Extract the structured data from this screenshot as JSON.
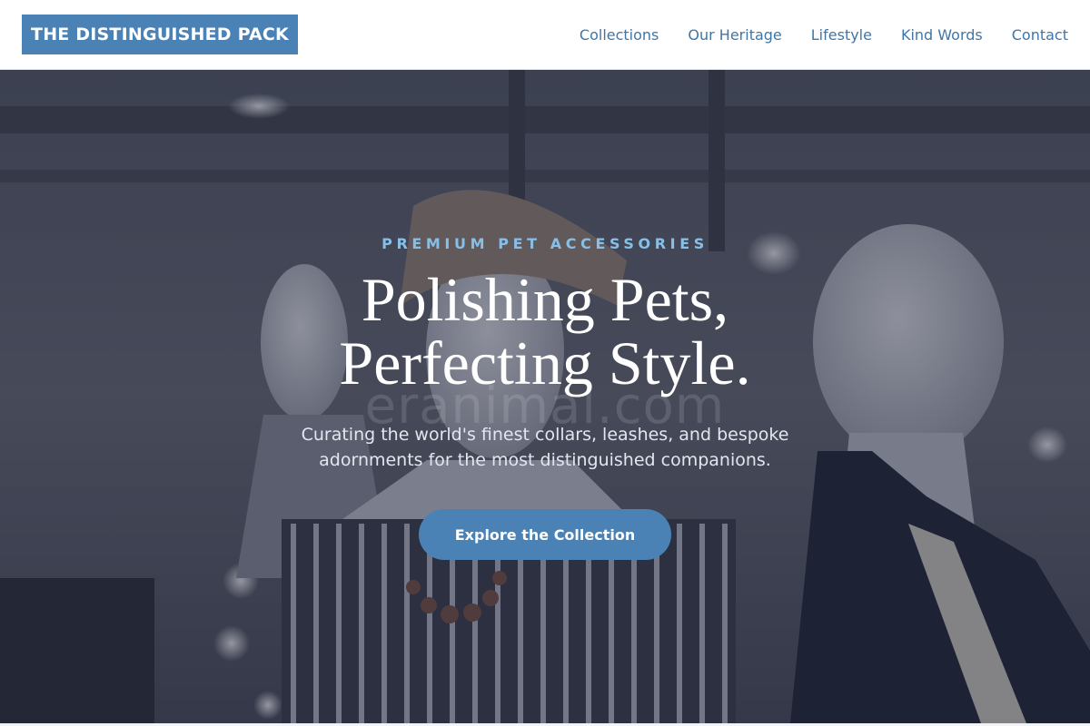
{
  "header": {
    "logo": "THE DISTINGUISHED PACK",
    "nav": [
      {
        "label": "Collections"
      },
      {
        "label": "Our Heritage"
      },
      {
        "label": "Lifestyle"
      },
      {
        "label": "Kind Words"
      },
      {
        "label": "Contact"
      }
    ]
  },
  "hero": {
    "eyebrow": "PREMIUM PET ACCESSORIES",
    "headline_line1": "Polishing Pets,",
    "headline_line2": "Perfecting Style.",
    "subtext": "Curating the world's finest collars, leashes, and bespoke adornments for the most distinguished companions.",
    "cta_label": "Explore the Collection",
    "watermark": "eranimal.com"
  },
  "colors": {
    "brand": "#4a82b6",
    "nav_link": "#3f76a8",
    "eyebrow": "#86c0e8",
    "hero_overlay": "#1c2238"
  }
}
